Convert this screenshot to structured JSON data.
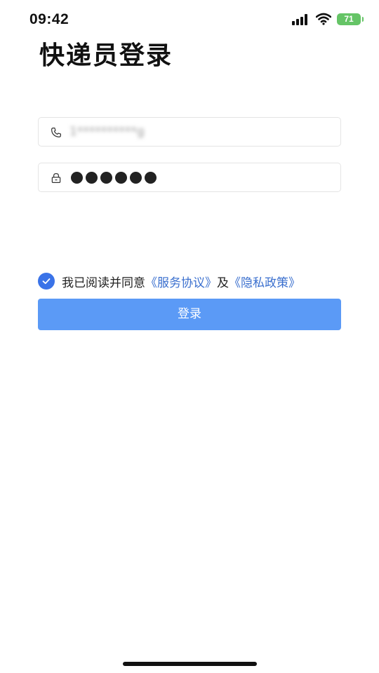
{
  "status_bar": {
    "time": "09:42",
    "battery": "71",
    "icons": [
      "signal-icon",
      "wifi-icon",
      "battery-icon"
    ]
  },
  "page": {
    "title": "快递员登录"
  },
  "form": {
    "phone": {
      "icon": "phone-icon",
      "value": "1**********g"
    },
    "password": {
      "icon": "lock-icon",
      "masked_length": 6
    },
    "agreement": {
      "checked": true,
      "text": "我已阅读并同意",
      "service_link": "《服务协议》",
      "and": "及",
      "privacy_link": "《隐私政策》"
    },
    "login_label": "登录"
  },
  "colors": {
    "accent": "#5b9af6",
    "check": "#3a73e8",
    "link": "#3a6fce",
    "battery": "#65c466"
  }
}
